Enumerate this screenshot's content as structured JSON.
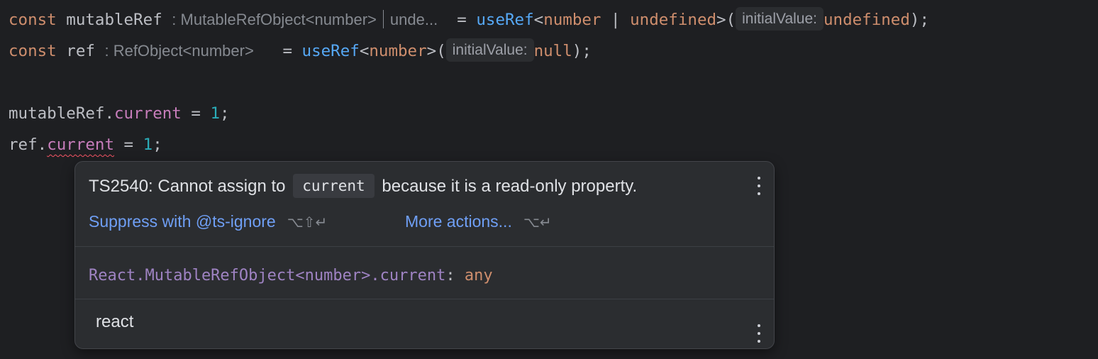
{
  "editor": {
    "line1": {
      "kw": "const",
      "name": "mutableRef",
      "type_hint_a": ": MutableRefObject<number>",
      "type_hint_b": "unde...",
      "eq": "=",
      "fn": "useRef",
      "generic_open": "<",
      "generic_type": "number",
      "pipe": " | ",
      "generic_type2": "undefined",
      "generic_close": ">(",
      "param_hint": "initialValue:",
      "arg": "undefined",
      "end": ");"
    },
    "line2": {
      "kw": "const",
      "name": "ref",
      "type_hint": ": RefObject<number>",
      "eq": "=",
      "fn": "useRef",
      "generic_open": "<",
      "generic_type": "number",
      "generic_close": ">(",
      "param_hint": "initialValue:",
      "arg": "null",
      "end": ");"
    },
    "line4": {
      "obj": "mutableRef",
      "dot": ".",
      "prop": "current",
      "eq": " = ",
      "num": "1",
      "end": ";"
    },
    "line5": {
      "obj": "ref",
      "dot": ".",
      "prop": "current",
      "eq": " = ",
      "num": "1",
      "end": ";"
    }
  },
  "popup": {
    "message_prefix": "TS2540: Cannot assign to",
    "message_code": "current",
    "message_suffix": "because it is a read-only property.",
    "suppress_label": "Suppress with @ts-ignore",
    "suppress_shortcut": "⌥⇧↵",
    "more_actions_label": "More actions...",
    "more_actions_shortcut": "⌥↵",
    "signature_name": "React.MutableRefObject<number>.current",
    "signature_colon": ":",
    "signature_type": "any",
    "module_name": "react",
    "menu_icon_top": "kebab-menu-icon",
    "menu_icon_bottom": "kebab-menu-icon"
  },
  "colors": {
    "background": "#1e1f22",
    "keyword": "#cf8e6d",
    "function": "#56a8f5",
    "number": "#2aacb8",
    "property": "#c77dbb",
    "link": "#6f9ff5",
    "error_underline": "#f75464",
    "popup_bg": "#2b2d30"
  }
}
